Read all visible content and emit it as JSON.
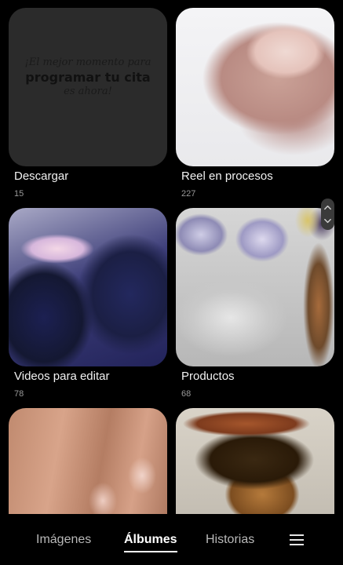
{
  "albums": [
    {
      "title": "Descargar",
      "count": "15",
      "thumbnail": "¡El mejor momento para programar tu cita es ahora!",
      "promo": {
        "line1": "¡El mejor momento para",
        "line2": "programar tu cita",
        "line3": "es ahora!"
      }
    },
    {
      "title": "Reel en procesos",
      "count": "227"
    },
    {
      "title": "Videos para editar",
      "count": "78"
    },
    {
      "title": "Productos",
      "count": "68"
    },
    {
      "title": "",
      "count": ""
    },
    {
      "title": "",
      "count": ""
    }
  ],
  "bottom_nav": {
    "tabs": [
      {
        "label": "Imágenes"
      },
      {
        "label": "Álbumes"
      },
      {
        "label": "Historias"
      }
    ],
    "active": "Álbumes",
    "menu_icon": "hamburger-menu-icon"
  },
  "icons": {
    "scroll_up": "chevron-up-icon",
    "scroll_down": "chevron-down-icon"
  },
  "colors": {
    "background": "#000000",
    "active_tab": "#ffffff",
    "inactive_tab": "#b9b9b9",
    "count_text": "#9a9a9a"
  }
}
